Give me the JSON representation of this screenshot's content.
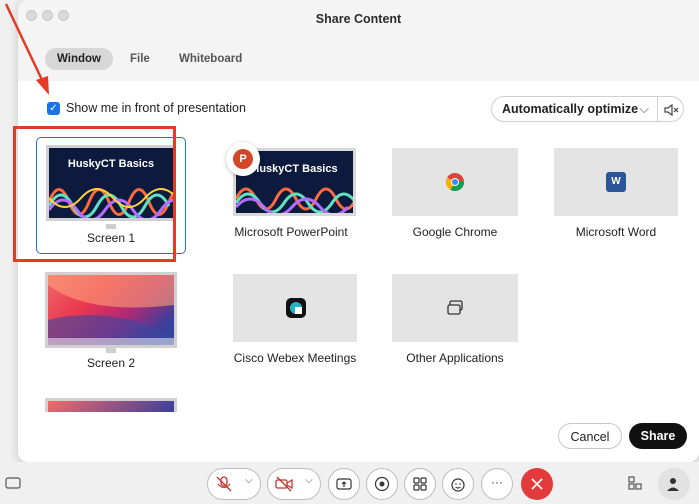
{
  "dialog": {
    "title": "Share Content"
  },
  "tabs": [
    {
      "label": "Window"
    },
    {
      "label": "File"
    },
    {
      "label": "Whiteboard"
    }
  ],
  "options": {
    "show_me_label": "Show me in front of presentation",
    "show_me_checked": true,
    "optimize_value": "Automatically optimize"
  },
  "tiles": [
    {
      "label": "Screen 1",
      "slide_title": "HuskyCT Basics"
    },
    {
      "label": "Microsoft PowerPoint",
      "slide_title": "HuskyCT Basics"
    },
    {
      "label": "Google Chrome"
    },
    {
      "label": "Microsoft Word"
    },
    {
      "label": "Screen 2"
    },
    {
      "label": "Cisco Webex Meetings"
    },
    {
      "label": "Other Applications"
    }
  ],
  "footer": {
    "cancel_label": "Cancel",
    "share_label": "Share"
  },
  "toolbar": {
    "items": [
      "mute-icon",
      "video-off-icon",
      "share-icon",
      "record-icon",
      "apps-icon",
      "reactions-icon",
      "more-icon",
      "end-call-icon",
      "layout-icon",
      "participants-icon"
    ]
  },
  "colors": {
    "accent": "#1a73e8",
    "annotation_red": "#e63b22",
    "end_call": "#e33b3b",
    "share_button": "#111111"
  }
}
